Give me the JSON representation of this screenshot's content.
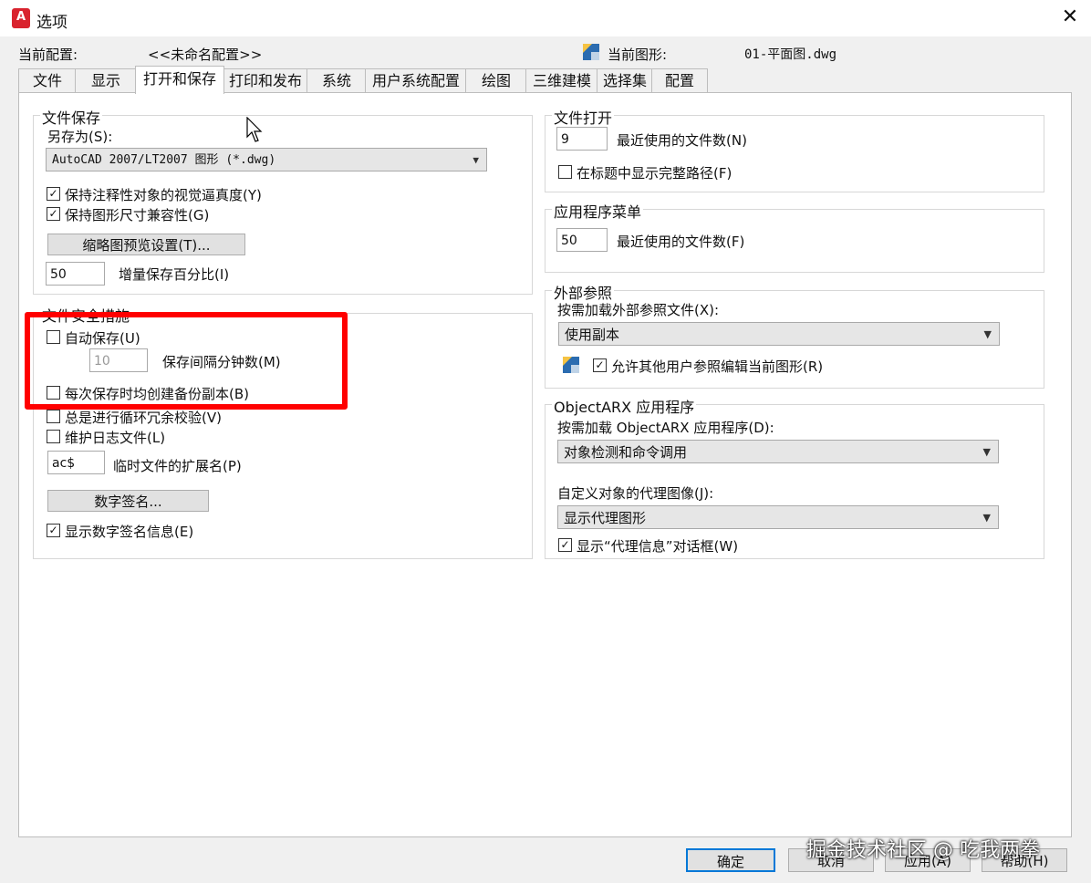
{
  "window": {
    "title": "选项",
    "app_icon": "A",
    "close": "✕"
  },
  "profile": {
    "current_profile_label": "当前配置:",
    "current_profile_value": "<<未命名配置>>",
    "current_drawing_label": "当前图形:",
    "current_drawing_value": "01-平面图.dwg"
  },
  "tabs": [
    "文件",
    "显示",
    "打开和保存",
    "打印和发布",
    "系统",
    "用户系统配置",
    "绘图",
    "三维建模",
    "选择集",
    "配置"
  ],
  "active_tab": "打开和保存",
  "file_save": {
    "title": "文件保存",
    "save_as_label": "另存为(S):",
    "save_as_value": "AutoCAD 2007/LT2007 图形 (*.dwg)",
    "maintain_visual_fidelity": {
      "label": "保持注释性对象的视觉逼真度(Y)",
      "checked": true
    },
    "maintain_drawing_size": {
      "label": "保持图形尺寸兼容性(G)",
      "checked": true
    },
    "thumbnail_button": "缩略图预览设置(T)...",
    "incremental_save_value": "50",
    "incremental_save_label": "增量保存百分比(I)"
  },
  "file_safety": {
    "title": "文件安全措施",
    "autosave": {
      "label": "自动保存(U)",
      "checked": false
    },
    "autosave_minutes_value": "10",
    "autosave_minutes_label": "保存间隔分钟数(M)",
    "backup_copy": {
      "label": "每次保存时均创建备份副本(B)",
      "checked": false
    },
    "crc_check": {
      "label": "总是进行循环冗余校验(V)",
      "checked": false
    },
    "log_file": {
      "label": "维护日志文件(L)",
      "checked": false
    },
    "temp_ext_value": "ac$",
    "temp_ext_label": "临时文件的扩展名(P)",
    "digital_sig_button": "数字签名...",
    "show_digital_sig": {
      "label": "显示数字签名信息(E)",
      "checked": true
    }
  },
  "file_open": {
    "title": "文件打开",
    "recent_value": "9",
    "recent_label": "最近使用的文件数(N)",
    "full_path": {
      "label": "在标题中显示完整路径(F)",
      "checked": false
    }
  },
  "app_menu": {
    "title": "应用程序菜单",
    "recent_value": "50",
    "recent_label": "最近使用的文件数(F)"
  },
  "xref": {
    "title": "外部参照",
    "demand_load_label": "按需加载外部参照文件(X):",
    "demand_load_value": "使用副本",
    "allow_edit": {
      "label": "允许其他用户参照编辑当前图形(R)",
      "checked": true
    }
  },
  "objectarx": {
    "title": "ObjectARX 应用程序",
    "demand_load_label": "按需加载 ObjectARX 应用程序(D):",
    "demand_load_value": "对象检测和命令调用",
    "proxy_label": "自定义对象的代理图像(J):",
    "proxy_value": "显示代理图形",
    "show_proxy_dialog": {
      "label": "显示“代理信息”对话框(W)",
      "checked": true
    }
  },
  "buttons": {
    "ok": "确定",
    "cancel": "取消",
    "apply": "应用(A)",
    "help": "帮助(H)"
  },
  "watermark": "掘金技术社区 @ 吃我两拳",
  "colors": {
    "highlight": "#ff0000",
    "accent": "#0078d7"
  }
}
